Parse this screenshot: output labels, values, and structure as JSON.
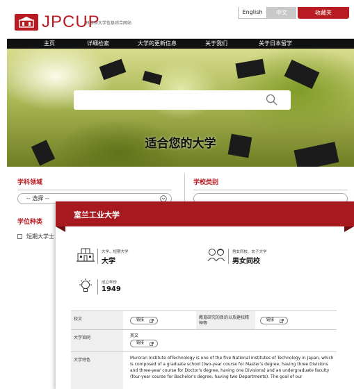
{
  "header": {
    "logo_text": "JPCUP",
    "logo_subtitle": "日本各大学信息综合网站",
    "lang_en": "English",
    "lang_zh": "中文",
    "favorite_button": "收藏夹"
  },
  "nav": {
    "items": [
      "主页",
      "详细检索",
      "大学的更新信息",
      "关于我们",
      "关于日本留学"
    ]
  },
  "hero": {
    "title": "适合您的大学",
    "search_placeholder": ""
  },
  "filters": {
    "field_label": "学科领域",
    "field_select": "-- 选择 --",
    "degree_label": "学位种类",
    "degree_option": "短期大学士",
    "school_type_label": "学校类别"
  },
  "modal": {
    "title": "室兰工业大学",
    "type_small": "大学、短期大学",
    "type_big": "大学",
    "gender_small": "男女同校、女子大学",
    "gender_big": "男女同校",
    "founded_small": "成立年份",
    "founded_big": "1949",
    "rows": {
      "school_song_label": "校文",
      "link_label": "链接",
      "purpose_label": "教育研究的目的以及建校精神等",
      "site_label": "大学官网",
      "site_lang": "英文",
      "features_label": "大学特色",
      "features_text": "Muroran Institute ofTechnology is one of the five National Institutes of Technology in Japan, which is composed of a graduate school (two-year course for Master's degree, having three Divisions and three-year course for Doctor's degree, having one Divisions) and an undergraduate faculty (four-year course for Bachelor's degree, having two Departments). The goal of our"
    }
  },
  "colors": {
    "brand_red": "#b81c22",
    "modal_red": "#a8191f",
    "nav_black": "#111111"
  }
}
